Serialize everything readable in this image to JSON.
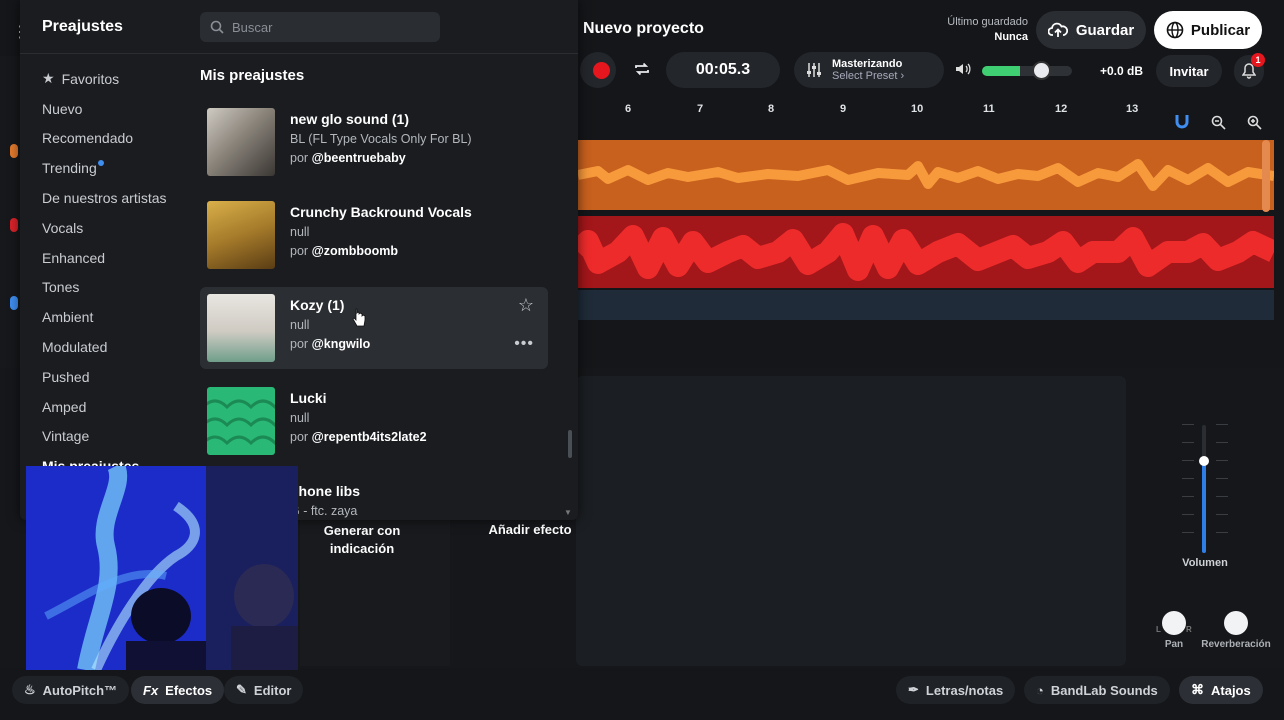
{
  "header": {
    "project_title": "Nuevo proyecto",
    "last_saved_label": "Último guardado",
    "last_saved_value": "Nunca",
    "save_label": "Guardar",
    "publish_label": "Publicar"
  },
  "transport": {
    "time": "00:05.3",
    "mastering_label": "Masterizando",
    "mastering_preset": "Select Preset ›",
    "db": "+0.0 dB",
    "invite_label": "Invitar",
    "notifications_count": "1",
    "meter_level": 0.42
  },
  "ruler": {
    "ticks": [
      "6",
      "7",
      "8",
      "9",
      "10",
      "11",
      "12",
      "13"
    ]
  },
  "presets_popup": {
    "title": "Preajustes",
    "search_placeholder": "Buscar",
    "section_title": "Mis preajustes",
    "categories": [
      {
        "label": "Favoritos"
      },
      {
        "label": "Nuevo"
      },
      {
        "label": "Recomendado"
      },
      {
        "label": "Trending"
      },
      {
        "label": "De nuestros artistas"
      },
      {
        "label": "Vocals"
      },
      {
        "label": "Enhanced"
      },
      {
        "label": "Tones"
      },
      {
        "label": "Ambient"
      },
      {
        "label": "Modulated"
      },
      {
        "label": "Pushed"
      },
      {
        "label": "Amped"
      },
      {
        "label": "Vintage"
      },
      {
        "label": "Mis preajustes"
      }
    ],
    "items": [
      {
        "name": "new glo sound (1)",
        "desc": "BL (FL Type Vocals Only For BL)",
        "by_prefix": "por",
        "author": "@beentruebaby"
      },
      {
        "name": "Crunchy Backround Vocals",
        "desc": "null",
        "by_prefix": "por",
        "author": "@zombboomb"
      },
      {
        "name": "Kozy (1)",
        "desc": "null",
        "by_prefix": "por",
        "author": "@kngwilo"
      },
      {
        "name": "Lucki",
        "desc": "null",
        "by_prefix": "por",
        "author": "@repentb4its2late2"
      },
      {
        "name": "phone libs",
        "desc": "G - ftc. zaya",
        "by_prefix": "",
        "author": ""
      }
    ]
  },
  "fx_panel": {
    "generate_label": "Generar con indicación",
    "add_effect_label": "Añadir efecto",
    "volume_label": "Volumen",
    "volume_level": 0.72,
    "pan_label": "Pan",
    "pan_l": "L",
    "pan_r": "R",
    "reverb_label": "Reverberación"
  },
  "bottom_bar": {
    "autopitch_label": "AutoPitch™",
    "effects_label": "Efectos",
    "editor_label": "Editor",
    "lyrics_label": "Letras/notas",
    "sounds_label": "BandLab Sounds",
    "shortcuts_label": "Atajos"
  },
  "colors": {
    "track1": "#c8601e",
    "track2": "#a3161a",
    "accent_blue": "#2f7ee8",
    "record_red": "#e5161e"
  }
}
